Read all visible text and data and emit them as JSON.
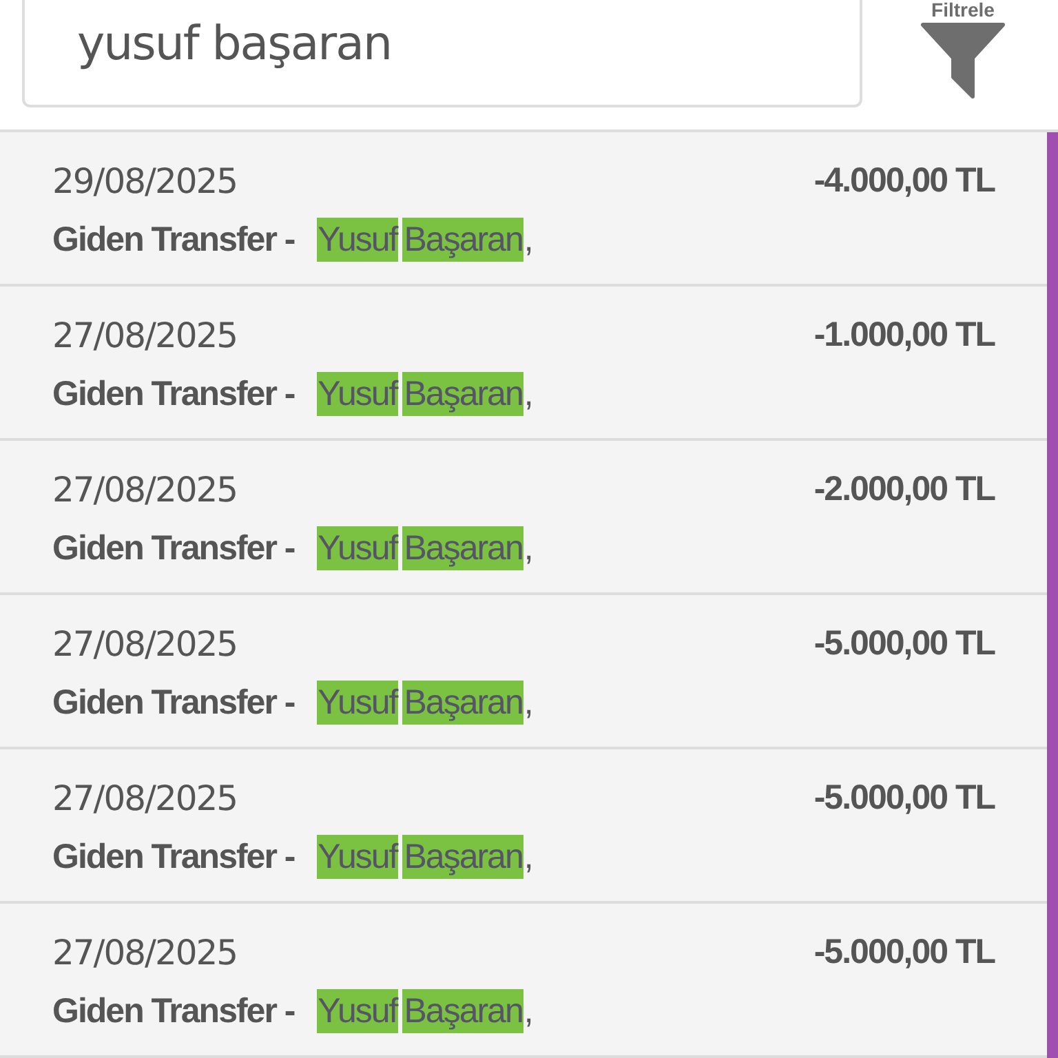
{
  "search": {
    "value": "yusuf başaran"
  },
  "filter": {
    "label": "Filtrele"
  },
  "transactions": [
    {
      "date": "29/08/2025",
      "amount": "-4.000,00 TL",
      "description": "Giden Transfer -",
      "payee_words": [
        "Yusuf",
        "Başaran"
      ],
      "suffix": ","
    },
    {
      "date": "27/08/2025",
      "amount": "-1.000,00 TL",
      "description": "Giden Transfer -",
      "payee_words": [
        "Yusuf",
        "Başaran"
      ],
      "suffix": ","
    },
    {
      "date": "27/08/2025",
      "amount": "-2.000,00 TL",
      "description": "Giden Transfer -",
      "payee_words": [
        "Yusuf",
        "Başaran"
      ],
      "suffix": ","
    },
    {
      "date": "27/08/2025",
      "amount": "-5.000,00 TL",
      "description": "Giden Transfer -",
      "payee_words": [
        "Yusuf",
        "Başaran"
      ],
      "suffix": ","
    },
    {
      "date": "27/08/2025",
      "amount": "-5.000,00 TL",
      "description": "Giden Transfer -",
      "payee_words": [
        "Yusuf",
        "Başaran"
      ],
      "suffix": ","
    },
    {
      "date": "27/08/2025",
      "amount": "-5.000,00 TL",
      "description": "Giden Transfer -",
      "payee_words": [
        "Yusuf",
        "Başaran"
      ],
      "suffix": ","
    }
  ]
}
